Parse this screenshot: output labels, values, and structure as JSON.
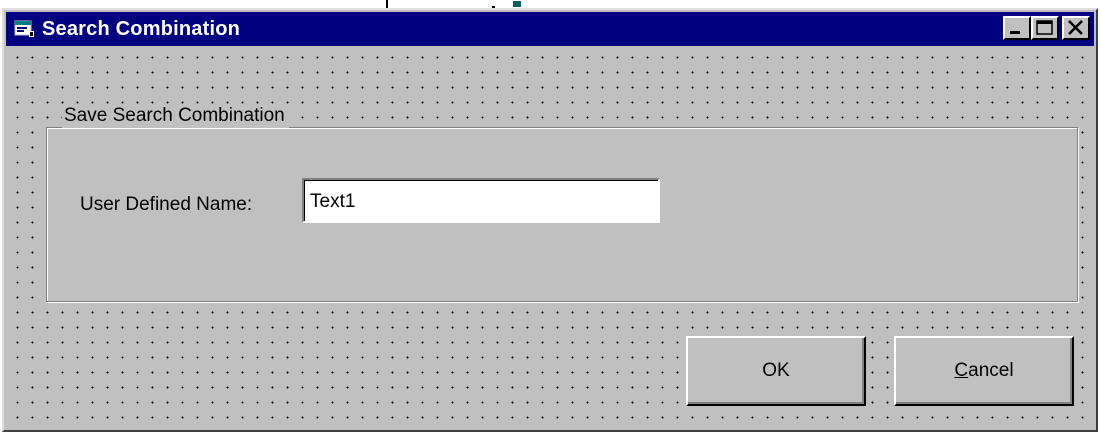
{
  "window": {
    "title": "Search Combination",
    "minimize_glyph": "_",
    "maximize_glyph": "□",
    "close_glyph": "✕"
  },
  "group": {
    "label": "Save Search Combination"
  },
  "form": {
    "name_label": "User Defined Name:",
    "name_value": "Text1"
  },
  "buttons": {
    "ok_label": "OK",
    "cancel_mnemonic": "C",
    "cancel_rest": "ancel"
  },
  "colors": {
    "titlebar": "#000080",
    "face": "#c0c0c0"
  }
}
